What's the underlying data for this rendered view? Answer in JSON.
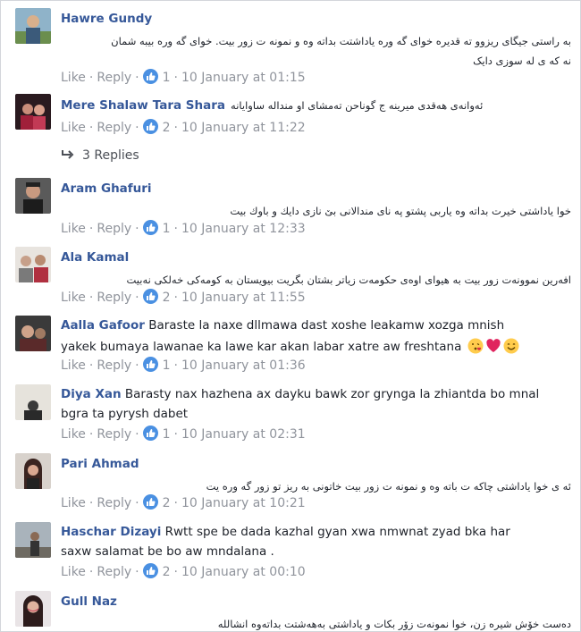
{
  "ui": {
    "like_label": "Like",
    "reply_label": "Reply",
    "dot": "·"
  },
  "comments": [
    {
      "author": "Hawre Gundy",
      "text_lines": [
        "به راستی جیگای ریزوو ته قدیره خوای گه وره یاداشتت بداته وه و نمونه ت زور بیت. خوای گه وره بیبه شمان",
        "نه که ی له سوزی دایک"
      ],
      "rtl": true,
      "likes": "1",
      "time": "10 January at 01:15"
    },
    {
      "author": "Mere Shalaw",
      "tagged": "Tara Shara",
      "text_lines": [
        "ئەوانەی ھەقدی میرینە ج گوناحن  تەمشای او مندالە ساوایانە"
      ],
      "rtl": false,
      "likes": "2",
      "time": "10 January at 11:22"
    },
    {
      "author": "Aram Ghafuri",
      "text_lines": [
        "خوا یاداشتی خیرت بداته وه یاربی پشتو په نای مندالانی بێ نازی دایك و باوك بیت"
      ],
      "rtl": true,
      "likes": "1",
      "time": "10 January at 12:33"
    },
    {
      "author": "Ala Kamal",
      "text_lines": [
        "افەرین نموونەت زور بیت بە ھیوای اوەی حکومەت زیاتر بشتان بگریت بیویستان بە کومەکی خەلکی نەبیت"
      ],
      "rtl": true,
      "likes": "2",
      "time": "10 January at 11:55"
    },
    {
      "author": "Aalla Gafoor",
      "text_lines": [
        "Baraste la naxe dllmawa dast xoshe leakamw xozga mnish",
        "yakek bumaya lawanae ka lawe kar akan labar xatre aw freshtana"
      ],
      "rtl": false,
      "likes": "1",
      "time": "10 January at 01:36"
    },
    {
      "author": "Diya Xan",
      "text_lines": [
        "Barasty nax hazhena ax dayku bawk zor grynga la zhiantda bo mnal",
        "bgra ta pyrysh dabet"
      ],
      "rtl": false,
      "likes": "1",
      "time": "10 January at 02:31"
    },
    {
      "author": "Pari Ahmad",
      "text_lines": [
        "ئە ی خوا یاداشتی چاکە ت باتە وە و نمونە ت زور بیت خاتونی بە ریز تو زور گە ورە یت"
      ],
      "rtl": true,
      "likes": "2",
      "time": "10 January at 10:21"
    },
    {
      "author": "Haschar Dizayi",
      "text_lines": [
        "Rwtt spe be dada kazhal gyan xwa nmwnat zyad bka har",
        "saxw salamat be bo aw mndalana ."
      ],
      "rtl": false,
      "likes": "2",
      "time": "10 January at 00:10"
    },
    {
      "author": "Gull Naz",
      "text_lines": [
        "دەست خۆش شیرە زن، خوا نمونەت زۆر بکات و یاداشتی بەھەشتت بداتەوە انشاللە"
      ],
      "rtl": true
    }
  ],
  "replies_label": "3 Replies",
  "colors": {
    "name": "#365899",
    "meta": "#90949c",
    "like_badge": "#4a90e2"
  }
}
